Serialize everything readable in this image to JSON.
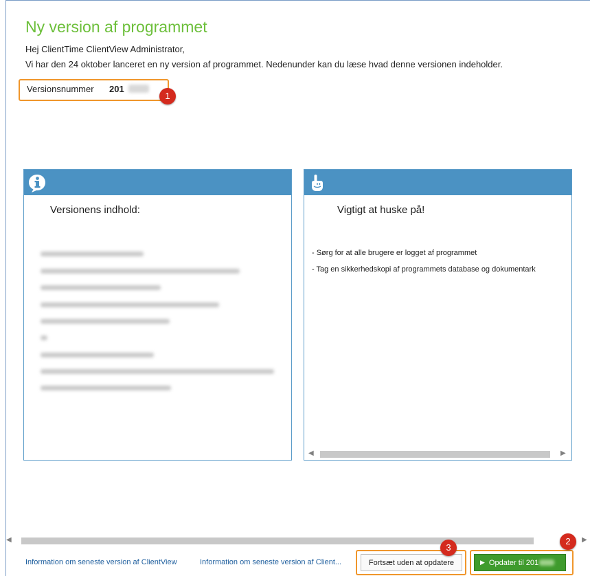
{
  "header": {
    "title": "Ny version af programmet",
    "greeting": "Hej ClientTime ClientView Administrator,",
    "intro": "Vi har den 24 oktober lanceret en ny version af programmet. Nedenunder kan du læse hvad denne versionen  indeholder."
  },
  "version": {
    "label": "Versionsnummer",
    "number": "201"
  },
  "badges": [
    "1",
    "2",
    "3"
  ],
  "panels": {
    "contents": {
      "icon": "info-icon",
      "title": "Versionens indhold:"
    },
    "remember": {
      "icon": "pointing-hand-icon",
      "title": "Vigtigt at huske på!",
      "items": [
        "- Sørg for at alle brugere er logget af programmet",
        "- Tag en sikkerhedskopi af programmets database og dokumentark"
      ]
    }
  },
  "footer": {
    "link1": "Information om seneste version af ClientView",
    "link2": "Information om seneste version af Client...",
    "continue_label": "Fortsæt uden at opdatere",
    "update_label": "Opdater til 201"
  },
  "colors": {
    "title": "#6cbf3a",
    "accent_orange": "#f0962b",
    "panel_header": "#4b92c3",
    "update_button": "#3f9b2d",
    "badge": "#d42a1e",
    "link": "#1f5f9e"
  }
}
